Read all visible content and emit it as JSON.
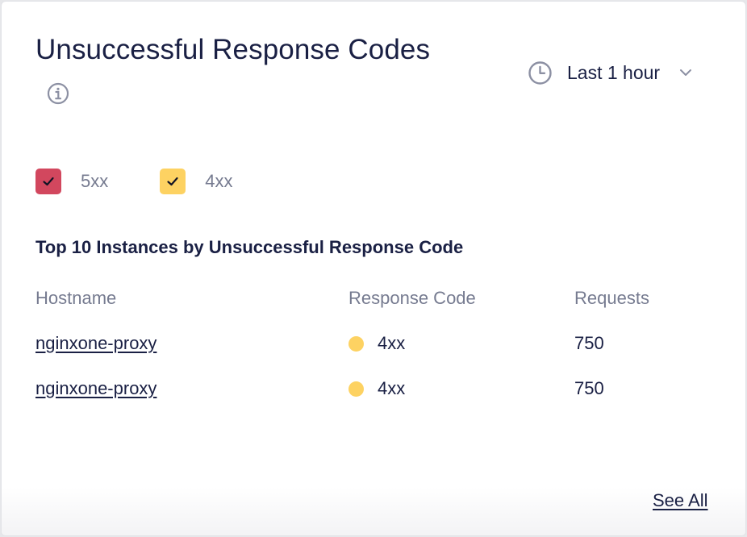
{
  "card": {
    "title": "Unsuccessful Response Codes",
    "info_icon": "info-icon",
    "time_range": {
      "icon": "clock-icon",
      "label": "Last 1 hour",
      "chevron_icon": "chevron-down-icon"
    },
    "legend": [
      {
        "label": "5xx",
        "checked": true,
        "color": "#d2475e"
      },
      {
        "label": "4xx",
        "checked": true,
        "color": "#fdd262"
      }
    ],
    "table_title": "Top 10 Instances by Unsuccessful Response Code",
    "columns": [
      "Hostname",
      "Response Code",
      "Requests"
    ],
    "rows": [
      {
        "hostname": "nginxone-proxy",
        "code": "4xx",
        "code_color": "#fdd262",
        "requests": "750"
      },
      {
        "hostname": "nginxone-proxy",
        "code": "4xx",
        "code_color": "#fdd262",
        "requests": "750"
      }
    ],
    "see_all": "See All"
  }
}
